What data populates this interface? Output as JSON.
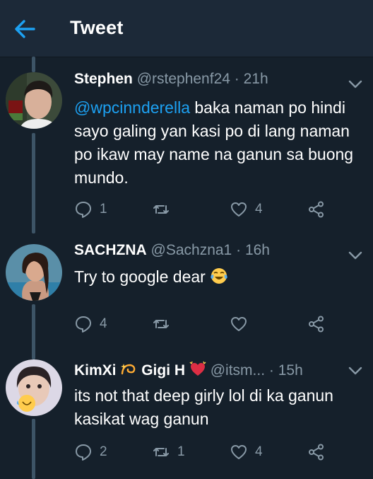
{
  "header": {
    "title": "Tweet",
    "back_icon": "back-arrow-icon"
  },
  "colors": {
    "background": "#15202b",
    "header": "#1c2938",
    "accent": "#1da1f2",
    "muted": "#8899a6",
    "heart_red": "#e0245e"
  },
  "tweets": [
    {
      "name": "Stephen",
      "handle": "@rstephenf24",
      "sep": "·",
      "time": "21h",
      "mention": "@wpcinnderella",
      "text": " baka naman po hindi sayo galing yan kasi po di lang naman po ikaw may name na ganun sa buong mundo.",
      "replies": "1",
      "retweets": "",
      "likes": "4"
    },
    {
      "name": "SACHZNA",
      "handle": "@Sachzna1",
      "sep": "·",
      "time": "16h",
      "text": "Try to google dear",
      "emoji": "face-with-tears-of-joy",
      "replies": "4",
      "retweets": "",
      "likes": ""
    },
    {
      "name_part1": "KimXi",
      "emoji_dizzy": "dizzy-icon",
      "name_part2": "Gigi H",
      "emoji_heart": "growing-heart-icon",
      "handle": "@itsm...",
      "sep": "·",
      "time": "15h",
      "text": "its not that deep girly lol di ka ganun kasikat wag ganun",
      "replies": "2",
      "retweets": "1",
      "likes": "4"
    }
  ]
}
